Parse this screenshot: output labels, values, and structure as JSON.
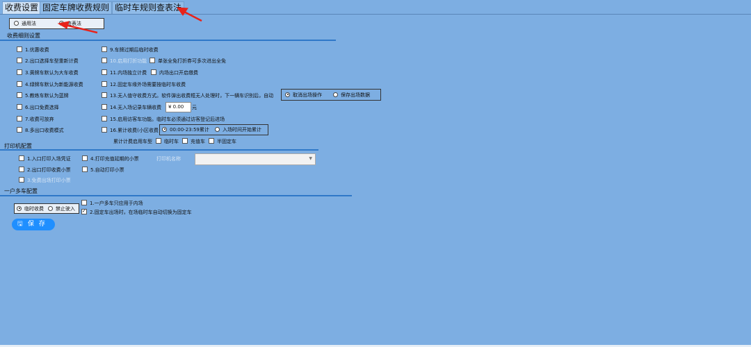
{
  "tabs": [
    "收费设置",
    "固定车牌收费规则",
    "临时车规则查表法"
  ],
  "method": {
    "option1": "通用法",
    "option2": "查表法"
  },
  "fee_section": {
    "title": "收费细则设置",
    "left_items": [
      "1.优惠收费",
      "2.出口选择车型重新计费",
      "3.黄牌车默认为大车收费",
      "4.绿牌车默认为新能源收费",
      "5.教练车默认为蓝牌",
      "6.出口免费选择",
      "7.收费可放弃",
      "8.多出口收费模式"
    ],
    "item9": "9.车牌过期后临时收费",
    "item10": "10.启用打折功能",
    "item10b": "单张全免打折券可多次进出全免",
    "item11": "11.内场独立计费",
    "item11b": "内场出口开启缴费",
    "item12": "12.固定车缘外场需要按临时车收费",
    "item13": "13.无人值守收费方式。软件弹出收费框无人处理时，下一辆车识别后，自动",
    "item13_opt1": "取消出场操作",
    "item13_opt2": "保存出场数据",
    "item14": "14.无入场记录车辆收费",
    "item14_value": "¥ 0.00",
    "item14_unit": "元",
    "item15": "15.启用访客车功能。临时车必须通过访客登记后进场",
    "item16": "16.累计收费(小区收费",
    "item16_opt1": "00:00-23:59累计",
    "item16_opt2": "入场时间开始累计",
    "cumulative_label": "累计计费启用车型",
    "cumulative_opts": [
      "临时车",
      "充值车",
      "半固定车"
    ]
  },
  "printer_section": {
    "title": "打印机配置",
    "item1": "1.入口打印入场凭证",
    "item2": "2.出口打印收费小票",
    "item3": "3.免费出场打印小票",
    "item4": "4.打印充值延期的小票",
    "item5": "5.自动打印小票",
    "printer_name_label": "打印机名称"
  },
  "multi_section": {
    "title": "一户多车配置",
    "radio1": "临时收费",
    "radio2": "禁止驶入",
    "item1": "1.一户多车只应用于内场",
    "item2": "2.固定车出场时，在场临时车自动切换为固定车"
  },
  "save_label": "保 存",
  "colors": {
    "background": "#7daee2",
    "accent": "#2f78c8",
    "save_button": "#1f8fff",
    "arrow": "#e8231a"
  }
}
